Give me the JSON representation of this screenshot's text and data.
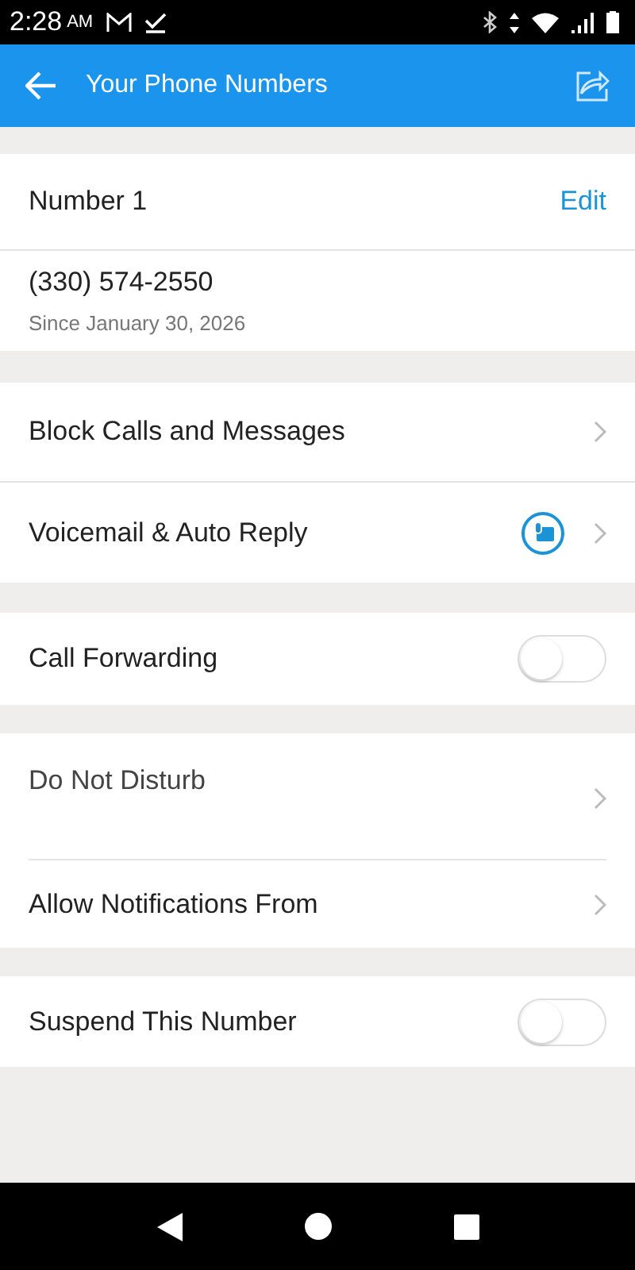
{
  "status_bar": {
    "time": "2:28",
    "ampm": "AM"
  },
  "app_bar": {
    "title": "Your Phone Numbers"
  },
  "number_card": {
    "label": "Number 1",
    "edit": "Edit",
    "phone": "(330) 574-2550",
    "since": "Since January 30, 2026"
  },
  "sections": [
    {
      "rows": [
        {
          "kind": "chevron",
          "label": "Block Calls and Messages"
        },
        {
          "kind": "voicemail",
          "label": "Voicemail & Auto Reply"
        }
      ]
    },
    {
      "rows": [
        {
          "kind": "toggle",
          "label": "Call Forwarding",
          "on": false
        }
      ]
    },
    {
      "rows": [
        {
          "kind": "tall",
          "label": "Do Not Disturb"
        },
        {
          "kind": "chevron",
          "label": "Allow Notifications From"
        }
      ]
    },
    {
      "rows": [
        {
          "kind": "toggle",
          "label": "Suspend This Number",
          "on": false
        }
      ]
    }
  ]
}
